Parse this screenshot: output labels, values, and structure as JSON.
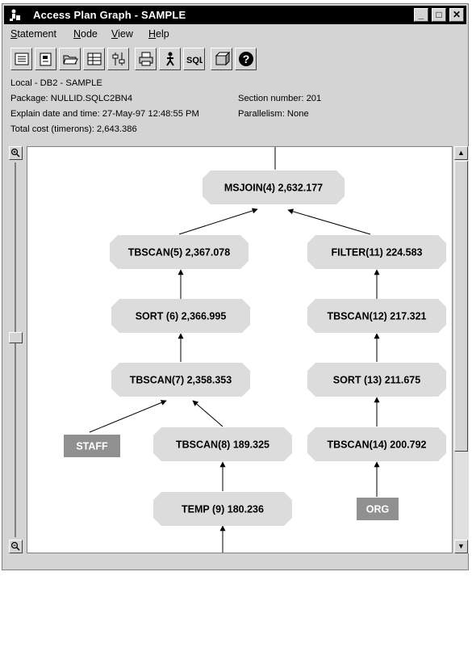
{
  "window": {
    "title": "Access Plan Graph - SAMPLE",
    "controls": [
      "_",
      "□",
      "✕"
    ]
  },
  "menu": {
    "statement": "Statement",
    "node": "Node",
    "view": "View",
    "help": "Help"
  },
  "toolbar": {
    "icons": [
      "list-icon",
      "details-icon",
      "open-folder-icon",
      "table-icon",
      "settings-icon",
      "print-icon",
      "explain-icon",
      "sql-icon",
      "package-icon",
      "help-icon"
    ],
    "sql_label": "SQL",
    "help_glyph": "?"
  },
  "info": {
    "location": "Local - DB2 - SAMPLE",
    "package": "Package: NULLID.SQLC2BN4",
    "section": "Section number: 201",
    "explain": "Explain date and time: 27-May-97 12:48:55 PM",
    "parallelism": "Parallelism: None",
    "total_cost": "Total cost (timerons): 2,643.386"
  },
  "graph": {
    "nodes": [
      {
        "id": "msjoin",
        "label": "MSJOIN(4) 2,632.177",
        "kind": "operator"
      },
      {
        "id": "tbscan5",
        "label": "TBSCAN(5) 2,367.078",
        "kind": "operator"
      },
      {
        "id": "filter11",
        "label": "FILTER(11) 224.583",
        "kind": "operator"
      },
      {
        "id": "sort6",
        "label": "SORT (6) 2,366.995",
        "kind": "operator"
      },
      {
        "id": "tbscan12",
        "label": "TBSCAN(12) 217.321",
        "kind": "operator"
      },
      {
        "id": "tbscan7",
        "label": "TBSCAN(7) 2,358.353",
        "kind": "operator"
      },
      {
        "id": "sort13",
        "label": "SORT (13) 211.675",
        "kind": "operator"
      },
      {
        "id": "staff",
        "label": "STAFF",
        "kind": "table"
      },
      {
        "id": "tbscan8",
        "label": "TBSCAN(8) 189.325",
        "kind": "operator"
      },
      {
        "id": "tbscan14",
        "label": "TBSCAN(14) 200.792",
        "kind": "operator"
      },
      {
        "id": "temp9",
        "label": "TEMP (9) 180.236",
        "kind": "operator"
      },
      {
        "id": "org",
        "label": "ORG",
        "kind": "table"
      }
    ]
  },
  "colors": {
    "operator_fill": "#dcdcdc",
    "table_fill": "#909090",
    "titlebar": "#000000",
    "chrome": "#d4d4d4"
  }
}
